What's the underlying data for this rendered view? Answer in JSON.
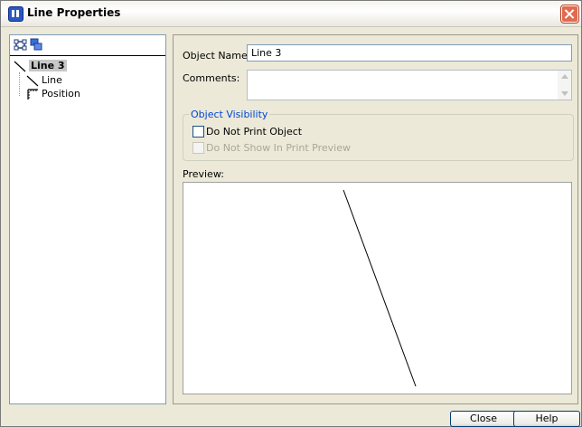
{
  "window": {
    "title": "Line Properties"
  },
  "tree": {
    "nodes": [
      {
        "label": "Line 3",
        "selected": true,
        "icon": "diagonal-line-icon"
      },
      {
        "label": "Line",
        "icon": "diagonal-line-icon"
      },
      {
        "label": "Position",
        "icon": "position-ruler-icon"
      }
    ],
    "toolbar_icons": [
      "connector-icon",
      "layers-icon"
    ]
  },
  "form": {
    "object_name_label": "Object Name:",
    "object_name_value": "Line 3",
    "comments_label": "Comments:",
    "comments_value": ""
  },
  "visibility": {
    "legend": "Object Visibility",
    "do_not_print": {
      "label": "Do Not Print Object",
      "checked": false,
      "enabled": true
    },
    "do_not_show_preview": {
      "label": "Do Not Show In Print Preview",
      "checked": false,
      "enabled": false
    }
  },
  "preview": {
    "label": "Preview:"
  },
  "buttons": {
    "close": "Close",
    "help": "Help"
  },
  "colors": {
    "legend": "#0046d5",
    "button_border": "#003c74",
    "selection": "#c7c7c7"
  }
}
